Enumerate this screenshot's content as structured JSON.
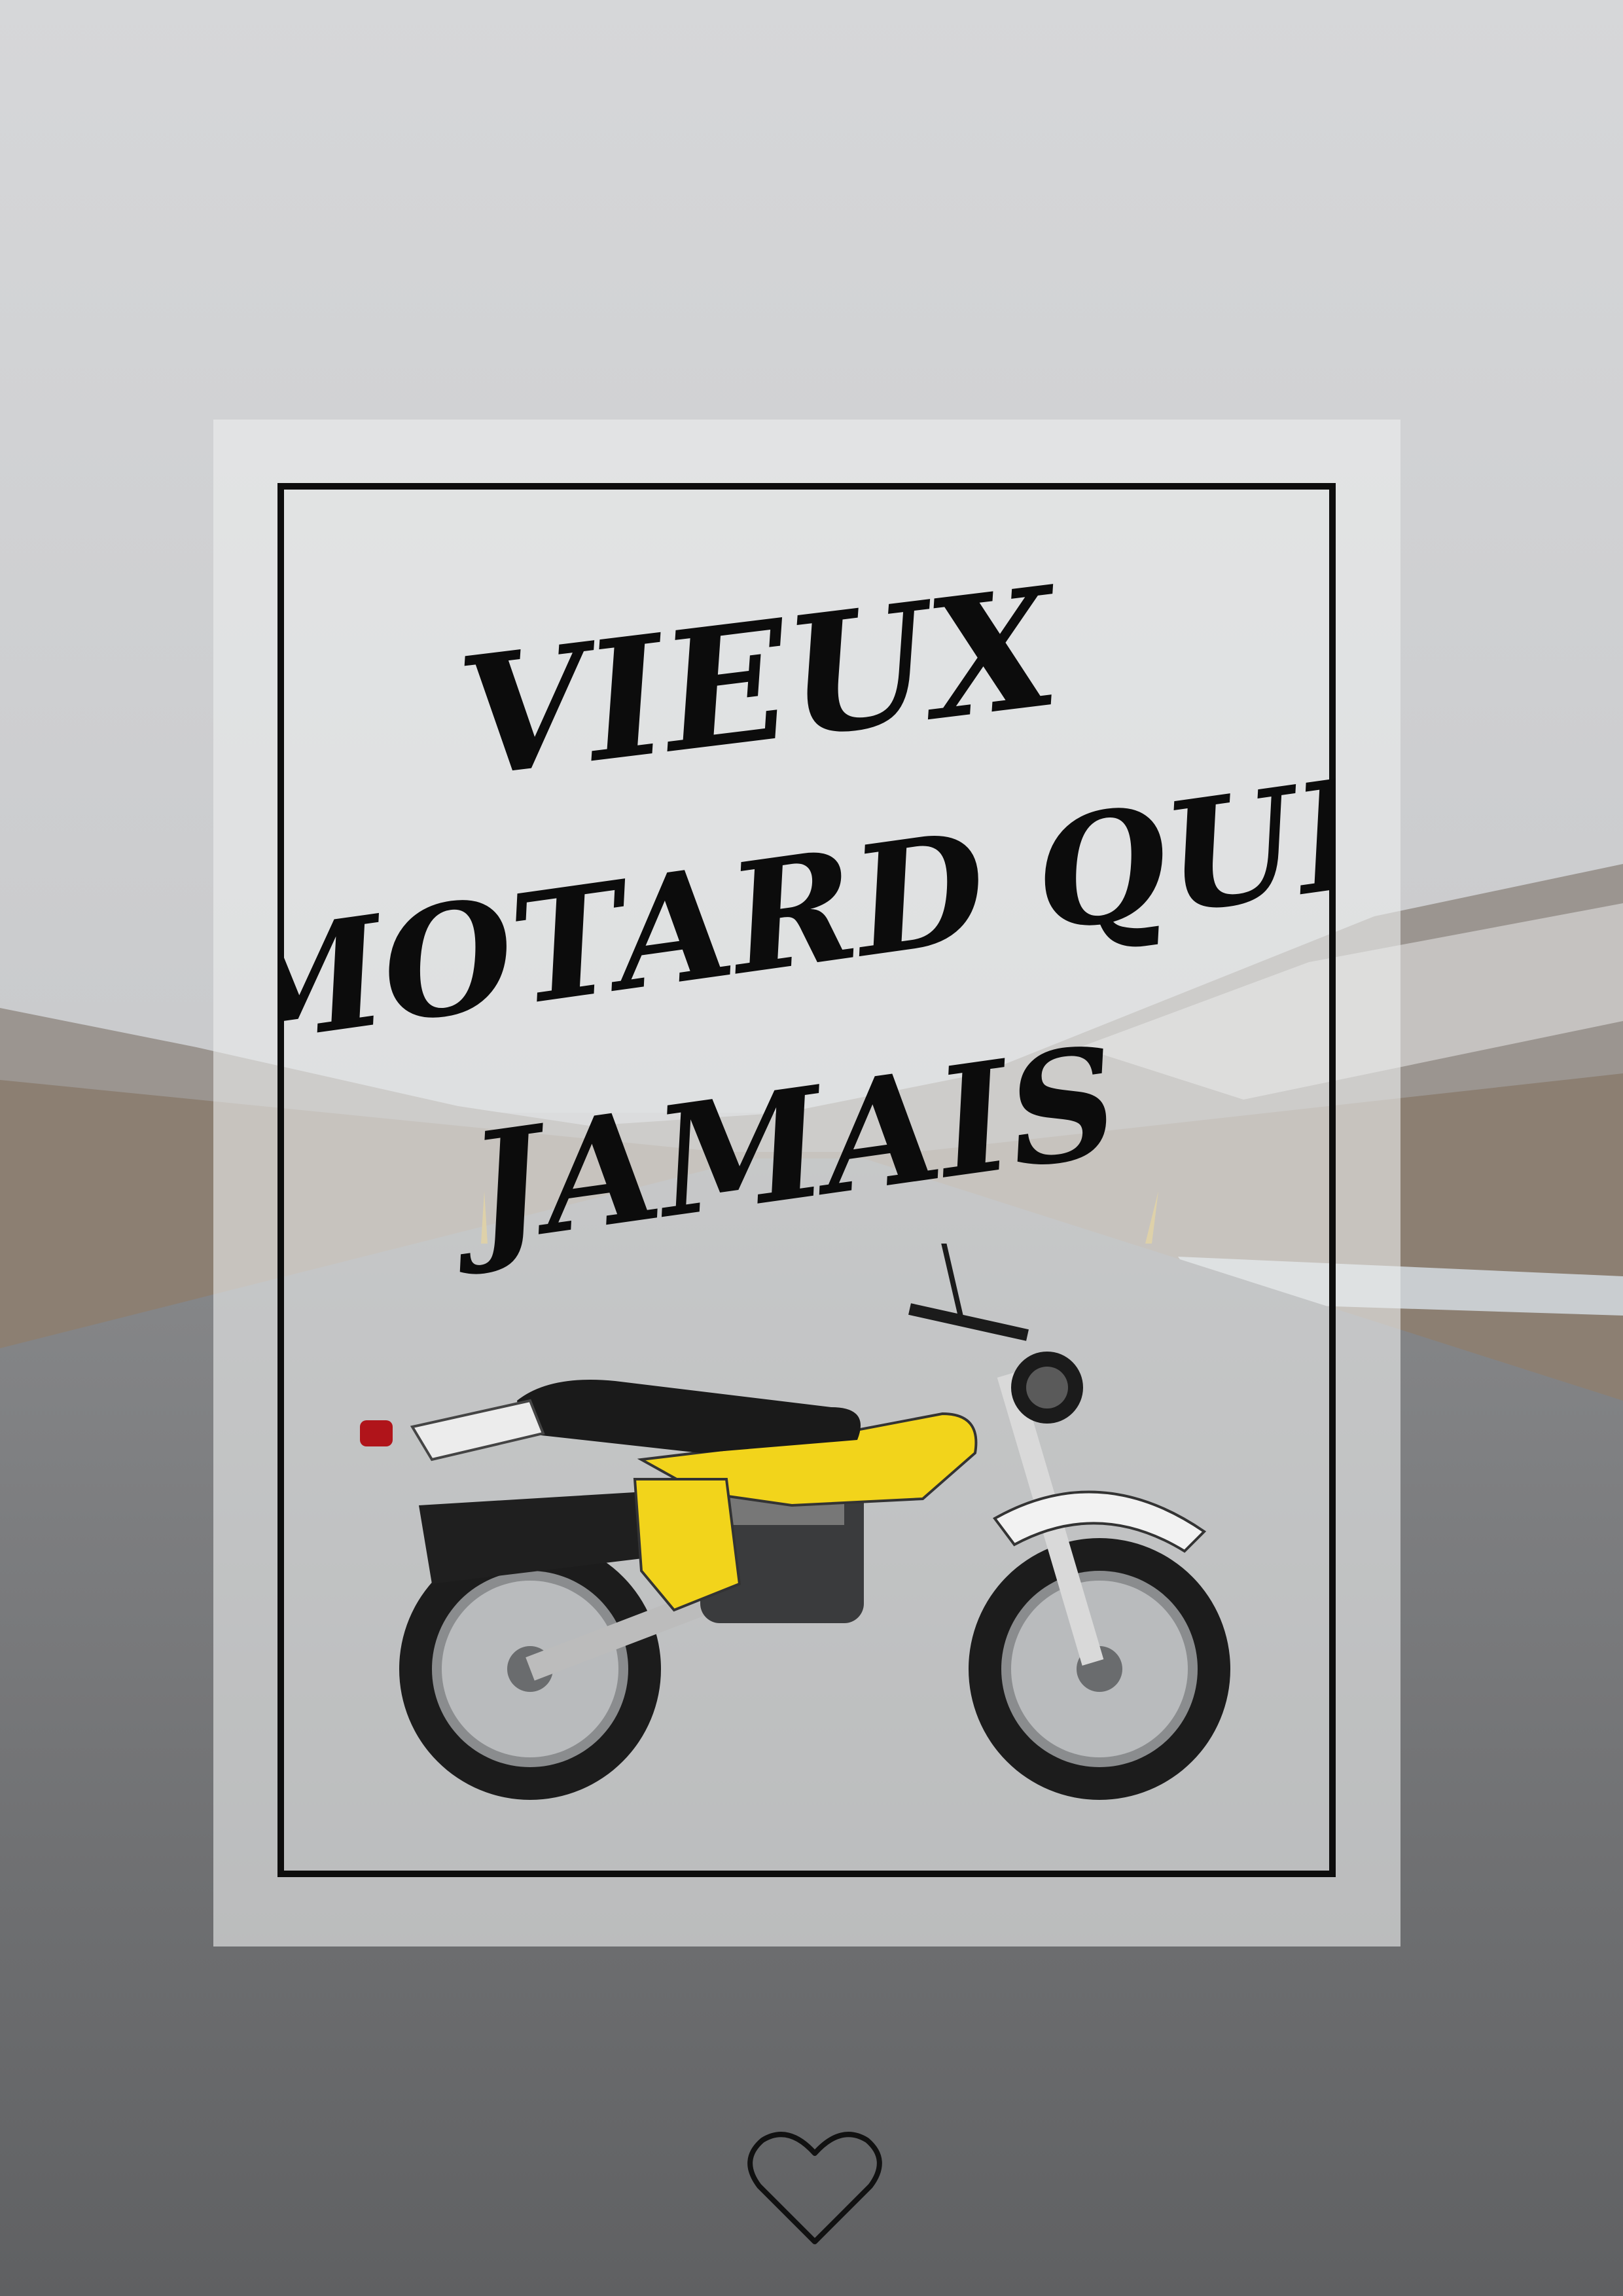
{
  "poster": {
    "title_lines": [
      "VIEUX",
      "MOTARD QUE",
      "JAMAIS"
    ]
  },
  "colors": {
    "sky": "#d7d8da",
    "road": "#6f7072",
    "hills": "#8f8377",
    "panel": "#ecedee",
    "frame": "#0d0d0d",
    "tank": "#f2d41b"
  },
  "icons": {
    "footer": "heart-outline-icon"
  }
}
